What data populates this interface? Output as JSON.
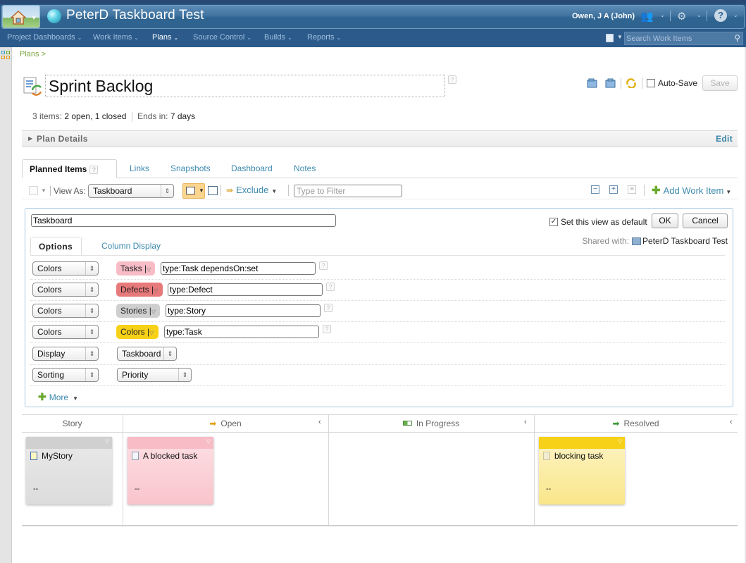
{
  "header": {
    "app_title": "PeterD Taskboard Test",
    "user_name": "Owen, J A (John)",
    "icons": [
      "home-icon",
      "project-globe-icon",
      "users-icon",
      "gear-icon",
      "help-icon"
    ]
  },
  "nav": {
    "items": [
      {
        "label": "Project Dashboards",
        "active": false
      },
      {
        "label": "Work Items",
        "active": false
      },
      {
        "label": "Plans",
        "active": true
      },
      {
        "label": "Source Control",
        "active": false
      },
      {
        "label": "Builds",
        "active": false
      },
      {
        "label": "Reports",
        "active": false
      }
    ],
    "search_placeholder": "Search Work Items"
  },
  "breadcrumb": "Plans >",
  "plan": {
    "title": "Sprint Backlog",
    "stats": {
      "items_label": "3 items:",
      "items_value": "2 open, 1 closed",
      "ends_label": "Ends in:",
      "ends_value": "7 days"
    },
    "auto_save_label": "Auto-Save",
    "auto_save_checked": false,
    "save_label": "Save",
    "details_label": "Plan Details",
    "edit_label": "Edit"
  },
  "tabs": [
    {
      "label": "Planned Items",
      "active": true
    },
    {
      "label": "Links",
      "active": false
    },
    {
      "label": "Snapshots",
      "active": false
    },
    {
      "label": "Dashboard",
      "active": false
    },
    {
      "label": "Notes",
      "active": false
    }
  ],
  "toolbar": {
    "view_as_label": "View As:",
    "view_as_value": "Taskboard",
    "exclude_label": "Exclude",
    "filter_placeholder": "Type to Filter",
    "add_work_item_label": "Add Work Item"
  },
  "view_editor": {
    "view_name": "Taskboard",
    "default_label": "Set this view as default",
    "default_checked": true,
    "ok_label": "OK",
    "cancel_label": "Cancel",
    "shared_label": "Shared with:",
    "shared_team": "PeterD Taskboard Test",
    "tabs": [
      {
        "label": "Options",
        "active": true
      },
      {
        "label": "Column Display",
        "active": false
      }
    ],
    "color_rules": [
      {
        "type": "Colors",
        "pill_label": "Tasks",
        "pill_color": "#f7bcc6",
        "query": "type:Task dependsOn:set"
      },
      {
        "type": "Colors",
        "pill_label": "Defects",
        "pill_color": "#e8797b",
        "query": "type:Defect"
      },
      {
        "type": "Colors",
        "pill_label": "Stories",
        "pill_color": "#cfcfcf",
        "query": "type:Story"
      },
      {
        "type": "Colors",
        "pill_label": "Colors",
        "pill_color": "#f7d117",
        "query": "type:Task"
      }
    ],
    "display": {
      "type": "Display",
      "value": "Taskboard"
    },
    "sorting": {
      "type": "Sorting",
      "value": "Priority"
    },
    "more_label": "More"
  },
  "taskboard": {
    "columns": [
      {
        "label": "Story",
        "icon": ""
      },
      {
        "label": "Open",
        "icon": "arrow-right-orange-icon"
      },
      {
        "label": "In Progress",
        "icon": "in-progress-icon"
      },
      {
        "label": "Resolved",
        "icon": "arrow-right-green-icon"
      }
    ],
    "cards": [
      {
        "column": "Story",
        "title": "MyStory",
        "status": "--",
        "header_color": "#d0d0d0",
        "body_color": "#e6e6e6",
        "icon": "story-icon"
      },
      {
        "column": "Open",
        "title": "A blocked task",
        "status": "--",
        "header_color": "#f7bcc6",
        "body_color": "#fbd2d8",
        "icon": "task-icon"
      },
      {
        "column": "Resolved",
        "title": "blocking task",
        "status": "--",
        "header_color": "#f7d117",
        "body_color": "#fbeb9a",
        "icon": "task-icon"
      }
    ]
  }
}
